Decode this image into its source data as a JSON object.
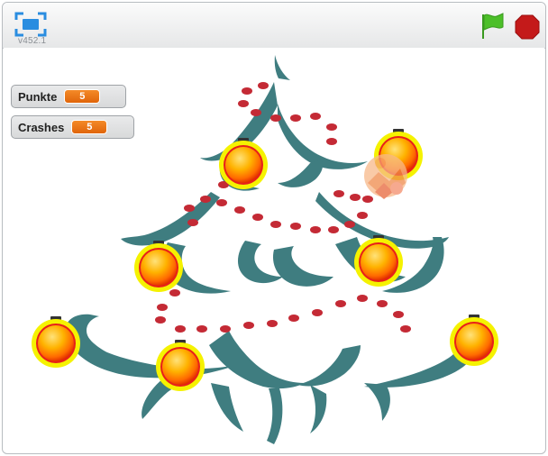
{
  "toolbar": {
    "version": "v452.1",
    "fullscreen_icon": "fullscreen-icon",
    "green_flag_icon": "green-flag-icon",
    "stop_icon": "stop-sign-icon"
  },
  "stage": {
    "variables": [
      {
        "label": "Punkte",
        "value": "5"
      },
      {
        "label": "Crashes",
        "value": "5"
      }
    ]
  },
  "colors": {
    "tree": "#3f7d80",
    "beads": "#c42a35",
    "ornament_outer": "#f5f200",
    "ornament_body": "#ff9500",
    "green_flag": "#4cbf29",
    "stop": "#c41a1a",
    "variable_value": "#f07d18"
  }
}
